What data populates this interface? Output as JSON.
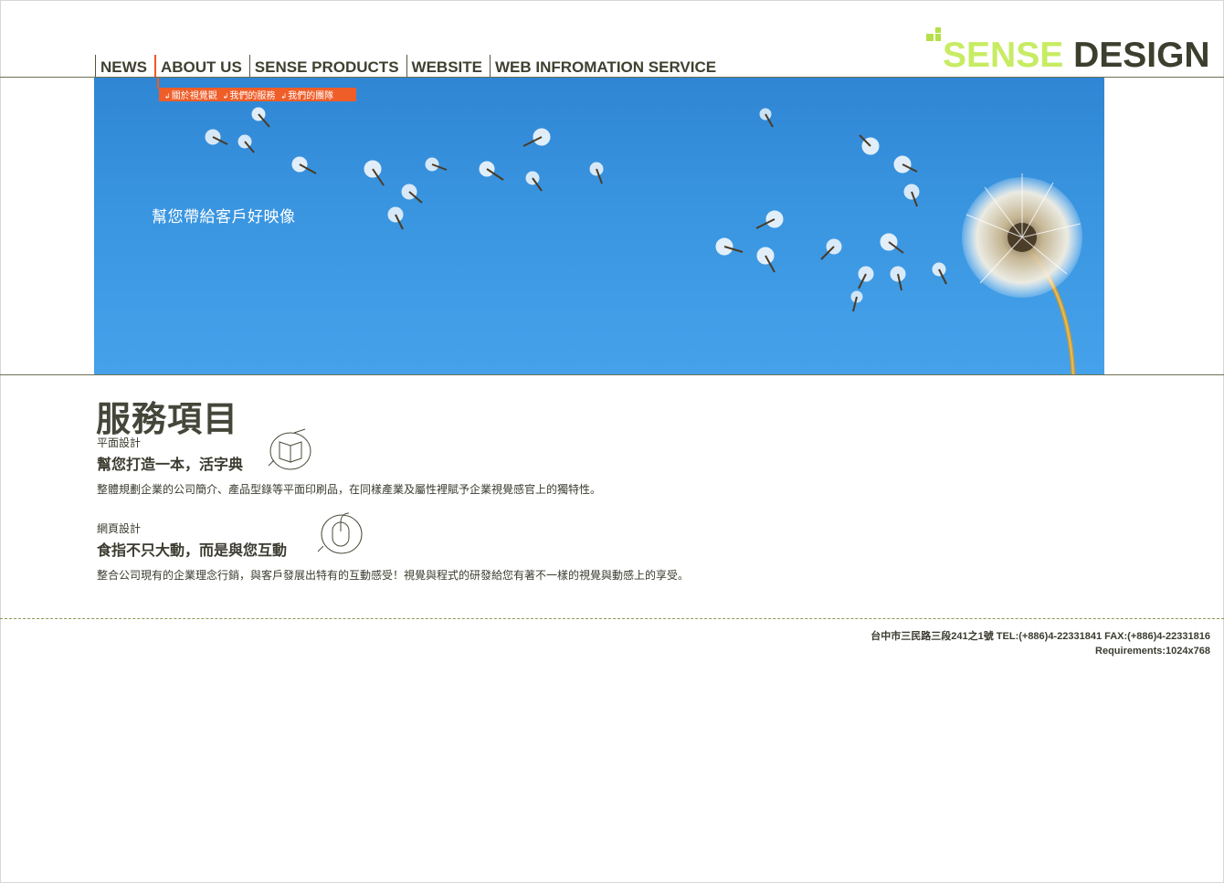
{
  "nav": {
    "items": [
      "NEWS",
      "ABOUT US",
      "SENSE PRODUCTS",
      "WEBSITE",
      "WEB INFROMATION SERVICE"
    ],
    "active": "ABOUT US"
  },
  "logo": {
    "part1": "SENSE",
    "part2": "DESIGN",
    "color_light": "#c7ec63",
    "color_dark": "#3d3f2e"
  },
  "submenu": {
    "items": [
      "關於視覺觀",
      "我們的服務",
      "我們的團隊"
    ],
    "color": "#ef5d28"
  },
  "hero": {
    "slogan": "幫您帶給客戶好映像",
    "sky_color": "#3a95e0"
  },
  "section": {
    "title": "服務項目",
    "services": [
      {
        "category": "平面設計",
        "headline": "幫您打造一本，活字典",
        "description": "整體規劃企業的公司簡介、產品型錄等平面印刷品，在同樣產業及屬性裡賦予企業視覺感官上的獨特性。",
        "icon": "book-icon"
      },
      {
        "category": "網頁設計",
        "headline": "食指不只大動，而是與您互動",
        "description": "整合公司現有的企業理念行銷，與客戶發展出特有的互動感受！視覺與程式的研發給您有著不一樣的視覺與動感上的享受。",
        "icon": "mouse-icon"
      }
    ]
  },
  "footer": {
    "line1": "台中市三民路三段241之1號  TEL:(+886)4-22331841  FAX:(+886)4-22331816",
    "line2": "Requirements:1024x768"
  }
}
